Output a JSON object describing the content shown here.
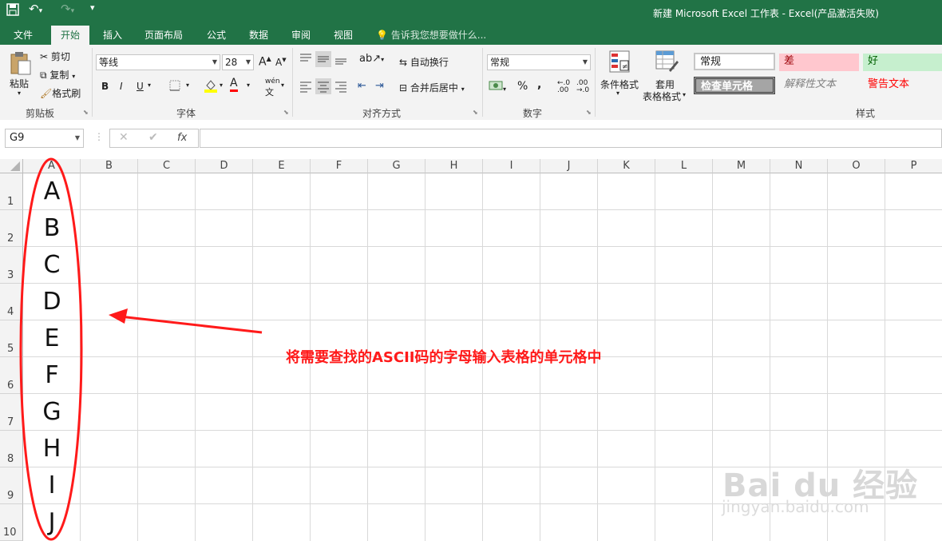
{
  "window": {
    "title": "新建 Microsoft Excel 工作表 - Excel(产品激活失败)"
  },
  "ribbon_tabs": [
    "文件",
    "开始",
    "插入",
    "页面布局",
    "公式",
    "数据",
    "审阅",
    "视图"
  ],
  "tell_me": "告诉我您想要做什么...",
  "clipboard": {
    "paste": "粘贴",
    "cut": "剪切",
    "copy": "复制",
    "format_painter": "格式刷",
    "label": "剪贴板"
  },
  "font": {
    "name": "等线",
    "size": "28",
    "bold": "B",
    "italic": "I",
    "underline": "U",
    "label": "字体",
    "phonetic": "wén"
  },
  "alignment": {
    "wrap": "自动换行",
    "merge": "合并后居中",
    "label": "对齐方式"
  },
  "number": {
    "format": "常规",
    "percent": "%",
    "comma": ",",
    "label": "数字"
  },
  "styles": {
    "conditional": "条件格式",
    "table_format": [
      "套用",
      "表格格式"
    ],
    "normal": "常规",
    "bad": "差",
    "good": "好",
    "check_cell": "检查单元格",
    "explanatory": "解释性文本",
    "warning": "警告文本",
    "label": "样式"
  },
  "formula_bar": {
    "name_box": "G9",
    "fx": "fx",
    "content": ""
  },
  "grid": {
    "columns": [
      "A",
      "B",
      "C",
      "D",
      "E",
      "F",
      "G",
      "H",
      "I",
      "J",
      "K",
      "L",
      "M",
      "N",
      "O",
      "P"
    ],
    "rows": [
      "1",
      "2",
      "3",
      "4",
      "5",
      "6",
      "7",
      "8",
      "9",
      "10"
    ],
    "column_a_values": [
      "A",
      "B",
      "C",
      "D",
      "E",
      "F",
      "G",
      "H",
      "I",
      "J"
    ]
  },
  "annotation": "将需要查找的ASCII码的字母输入表格的单元格中",
  "watermark": {
    "line1": "Bai du 经验",
    "line2": "jingyan.baidu.com"
  },
  "colors": {
    "excel_green": "#217346",
    "annotation_red": "#ff1a1a"
  }
}
